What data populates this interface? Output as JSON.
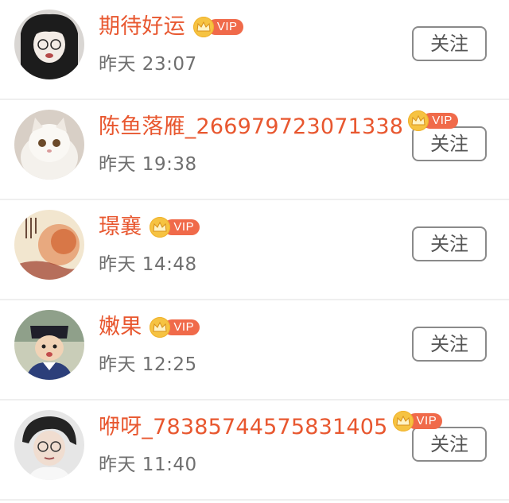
{
  "list": [
    {
      "name": "期待好运",
      "vip": "VIP",
      "time": "昨天 23:07",
      "follow": "关注"
    },
    {
      "name": "陈鱼落雁_266979723071338",
      "vip": "VIP",
      "time": "昨天 19:38",
      "follow": "关注"
    },
    {
      "name": "璟襄",
      "vip": "VIP",
      "time": "昨天 14:48",
      "follow": "关注"
    },
    {
      "name": "嫩果",
      "vip": "VIP",
      "time": "昨天 12:25",
      "follow": "关注"
    },
    {
      "name": "咿呀_78385744575831405",
      "vip": "VIP",
      "time": "昨天 11:40",
      "follow": "关注"
    }
  ],
  "colors": {
    "name": "#e8572f",
    "vip_pill": "#f06a4a",
    "vip_crown": "#f6c342"
  }
}
